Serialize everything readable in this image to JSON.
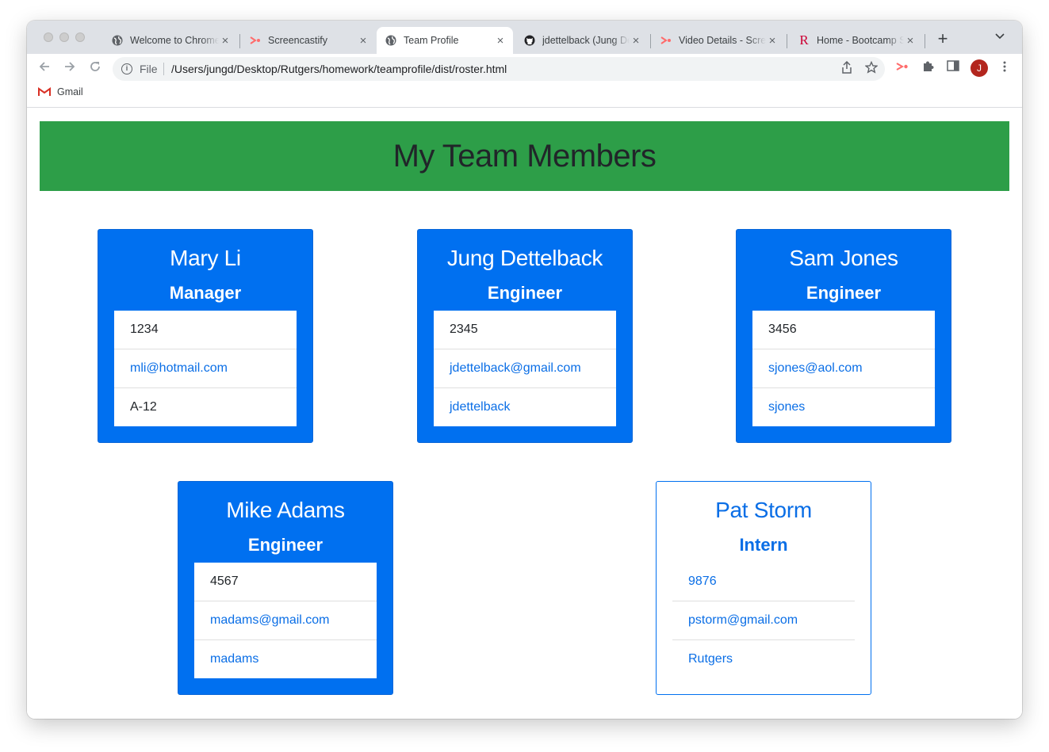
{
  "browser": {
    "tabs": [
      {
        "title": "Welcome to Chrome",
        "icon": "globe-icon"
      },
      {
        "title": "Screencastify",
        "icon": "screencastify-icon"
      },
      {
        "title": "Team Profile",
        "icon": "globe-icon",
        "active": true
      },
      {
        "title": "jdettelback (Jung Dettelback)",
        "icon": "github-icon"
      },
      {
        "title": "Video Details - Screencastify",
        "icon": "screencastify-icon"
      },
      {
        "title": "Home - Bootcamp Spot",
        "icon": "rutgers-icon"
      }
    ],
    "omnibox": {
      "scheme": "File",
      "url": "/Users/jungd/Desktop/Rutgers/homework/teamprofile/dist/roster.html"
    },
    "profile_initial": "J",
    "bookmarks": [
      {
        "label": "Gmail",
        "icon": "gmail-icon"
      }
    ]
  },
  "page": {
    "heading": "My Team Members",
    "employees": [
      {
        "name": "Mary Li",
        "role": "Manager",
        "id": "1234",
        "email": "mli@hotmail.com",
        "extra": "A-12"
      },
      {
        "name": "Jung Dettelback",
        "role": "Engineer",
        "id": "2345",
        "email": "jdettelback@gmail.com",
        "extra": "jdettelback"
      },
      {
        "name": "Sam Jones",
        "role": "Engineer",
        "id": "3456",
        "email": "sjones@aol.com",
        "extra": "sjones"
      },
      {
        "name": "Mike Adams",
        "role": "Engineer",
        "id": "4567",
        "email": "madams@gmail.com",
        "extra": "madams"
      },
      {
        "name": "Pat Storm",
        "role": "Intern",
        "id": "9876",
        "email": "pstorm@gmail.com",
        "extra": "Rutgers"
      }
    ]
  },
  "colors": {
    "header_green": "#2d9e48",
    "card_blue": "#0070f0",
    "link_blue": "#0a6ee6"
  }
}
